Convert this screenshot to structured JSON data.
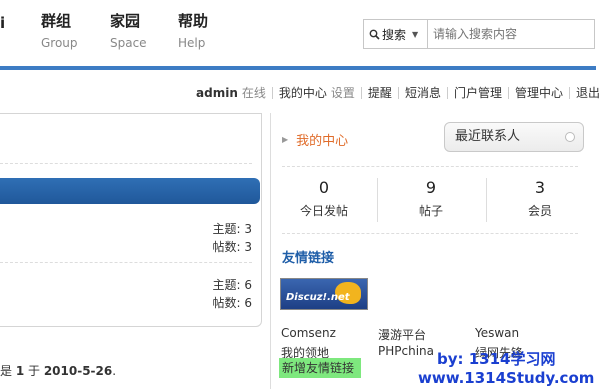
{
  "nav": {
    "partial_left_char": "i",
    "items": [
      {
        "zh": "群组",
        "en": "Group"
      },
      {
        "zh": "家园",
        "en": "Space"
      },
      {
        "zh": "帮助",
        "en": "Help"
      }
    ]
  },
  "search": {
    "type_label": "搜索",
    "placeholder": "请输入搜索内容"
  },
  "user_bar": {
    "username": "admin",
    "status": "在线",
    "my_center": "我的中心",
    "settings": "设置",
    "remind": "提醒",
    "messages": "短消息",
    "portal_admin": "门户管理",
    "admin_center": "管理中心",
    "logout": "退出"
  },
  "forum_rows": [
    {
      "topics": "主题: 3",
      "posts": "帖数: 3"
    },
    {
      "topics": "主题: 6",
      "posts": "帖数: 6"
    }
  ],
  "footer_text": {
    "prefix": "是 ",
    "num": "1",
    "mid": " 于 ",
    "date": "2010-5-26",
    "suffix": "."
  },
  "sidebar": {
    "my_center": "我的中心",
    "recent_contacts": "最近联系人",
    "stats": [
      {
        "value": "0",
        "label": "今日发帖"
      },
      {
        "value": "9",
        "label": "帖子"
      },
      {
        "value": "3",
        "label": "会员"
      }
    ],
    "friend_links_title": "友情链接",
    "logo_text": "Discuz!.net",
    "links": [
      "Comsenz",
      "漫游平台",
      "Yeswan",
      "我的领地",
      "PHPchina",
      "绿网先锋"
    ],
    "add_link": "新增友情链接"
  },
  "watermark": {
    "line1": "by: 1314学习网",
    "line2": "www.1314Study.com"
  },
  "colors": {
    "accent_blue": "#3d7cc4",
    "orange": "#e06c2a",
    "link_blue": "#1f5ea8",
    "add_link_green": "#7ee87e"
  }
}
